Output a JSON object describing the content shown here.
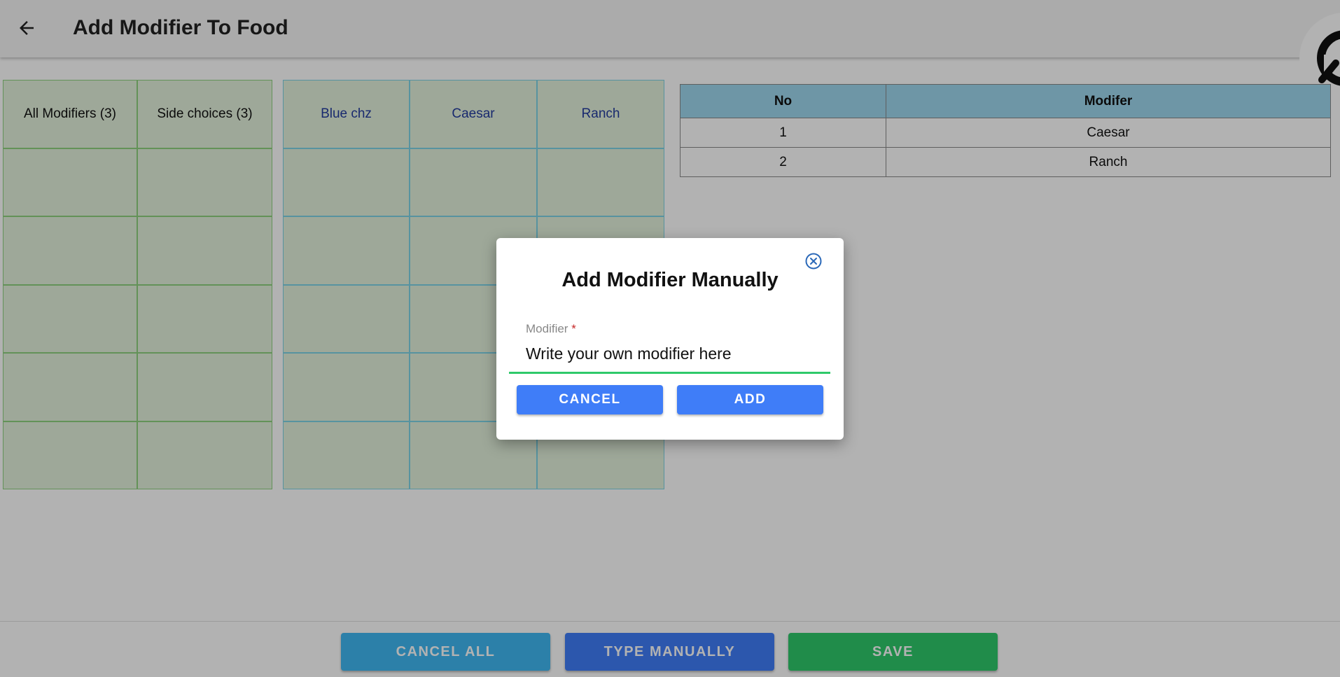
{
  "header": {
    "title": "Add Modifier To Food",
    "back_icon": "arrow-left-icon",
    "logo_icon": "search-logo-icon"
  },
  "left_grid": {
    "headers": [
      "All Modifiers (3)",
      "Side choices (3)"
    ]
  },
  "right_grid": {
    "headers": [
      "Blue chz",
      "Caesar",
      "Ranch"
    ]
  },
  "table": {
    "columns": [
      "No",
      "Modifer"
    ],
    "rows": [
      {
        "no": "1",
        "modifier": "Caesar"
      },
      {
        "no": "2",
        "modifier": "Ranch"
      }
    ]
  },
  "footer": {
    "cancel_all_label": "CANCEL ALL",
    "type_manually_label": "TYPE MANUALLY",
    "save_label": "SAVE"
  },
  "dialog": {
    "title": "Add Modifier Manually",
    "field_label": "Modifier",
    "required_mark": "*",
    "placeholder": "Write your own modifier here",
    "value": "",
    "cancel_label": "CANCEL",
    "add_label": "ADD",
    "close_icon": "close-circle-icon"
  },
  "colors": {
    "green_cell": "#e3f1dc",
    "grid_border_green": "#8fd17f",
    "grid_border_blue": "#7dd3e6",
    "table_header": "#9ed7ee",
    "primary_blue": "#3f7df8",
    "light_blue": "#3fb8f3",
    "green": "#2fc96a"
  }
}
